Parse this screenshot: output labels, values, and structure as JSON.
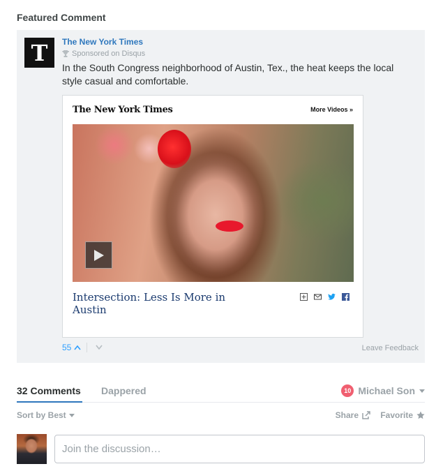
{
  "featured": {
    "heading": "Featured Comment",
    "publisher": "The New York Times",
    "publisher_logo_glyph": "T",
    "sponsored": "Sponsored on Disqus",
    "body": "In the South Congress neighborhood of Austin, Tex., the heat keeps the local style casual and comfortable.",
    "embed": {
      "logo": "The New York Times",
      "more_videos": "More Videos »",
      "video_title": "Intersection: Less Is More in Austin",
      "actions": [
        "expand-icon",
        "email-icon",
        "twitter-icon",
        "facebook-icon"
      ]
    },
    "votes": {
      "up": "55"
    },
    "leave_feedback": "Leave Feedback"
  },
  "tabs": {
    "comments": "32 Comments",
    "community": "Dappered"
  },
  "user": {
    "notifications": "10",
    "name": "Michael Son"
  },
  "sort": {
    "label": "Sort by Best",
    "share": "Share",
    "favorite": "Favorite"
  },
  "composer": {
    "placeholder": "Join the discussion…"
  },
  "colors": {
    "link_blue": "#2e77bd",
    "vote_blue": "#2e9fff",
    "muted": "#9aa2a7",
    "badge_red": "#f05f70",
    "card_bg": "#f0f2f4"
  }
}
